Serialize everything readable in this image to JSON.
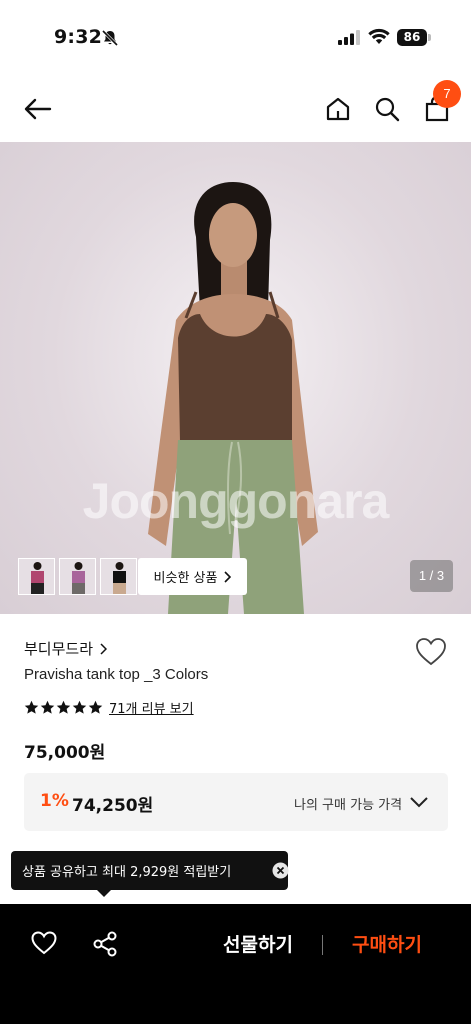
{
  "status_bar": {
    "time": "9:32",
    "battery": "86",
    "icons": [
      "bell-slash-icon",
      "signal-icon",
      "wifi-icon",
      "battery-icon"
    ]
  },
  "nav": {
    "icons": [
      "back-arrow-icon",
      "home-icon",
      "search-icon",
      "shopping-bag-icon"
    ],
    "cart_count": "7"
  },
  "gallery": {
    "watermark": "Joonggonara",
    "thumbnail_count": 3,
    "similar_label": "비슷한 상품",
    "page_counter": "1 / 3"
  },
  "product": {
    "brand": "부디무드라",
    "name": "Pravisha tank top _3 Colors",
    "rating_stars": 5,
    "review_link": "71개 리뷰 보기",
    "price": "75,000원"
  },
  "discount": {
    "rate": "1%",
    "price": "74,250원",
    "label": "나의 구매 가능 가격"
  },
  "tooltip": {
    "text": "상품 공유하고 최대 2,929원 적립받기"
  },
  "bottom_bar": {
    "gift_label": "선물하기",
    "buy_label": "구매하기"
  },
  "colors": {
    "accent": "#ff4e12",
    "bottom_bar": "#000000",
    "discount_bg": "#f4f4f4",
    "hero_bg": "#ddd4da"
  }
}
